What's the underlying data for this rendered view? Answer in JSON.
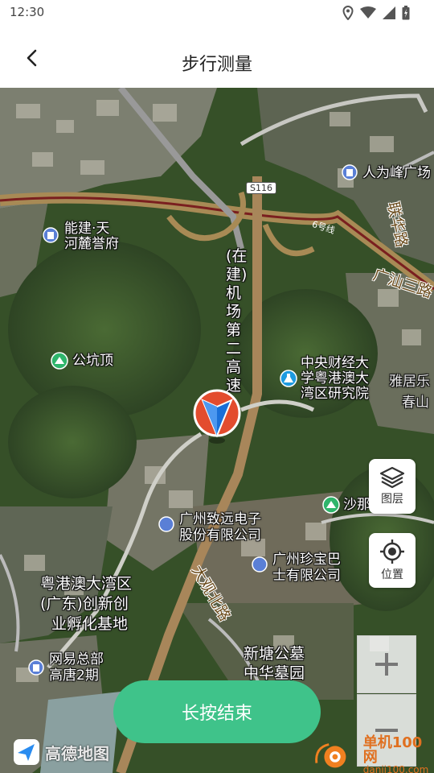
{
  "status_bar": {
    "time": "12:30"
  },
  "header": {
    "title": "步行测量"
  },
  "map": {
    "labels": {
      "renwei": "人为峰广场",
      "nengjian_1": "能建·天",
      "nengjian_2": "河麓誉府",
      "gongkengding": "公坑顶",
      "zhongyang_1": "中央财经大",
      "zhongyang_2": "学粤港澳大",
      "zhongyang_3": "湾区研究院",
      "yaju_1": "雅居乐",
      "yaju_2": "春山",
      "shana": "沙那",
      "zhiyuan_1": "广州致远电子",
      "zhiyuan_2": "股份有限公司",
      "zhenbao_1": "广州珍宝巴",
      "zhenbao_2": "士有限公司",
      "yuegang_1": "粤港澳大湾区",
      "yuegang_2": "(广东)创新创",
      "yuegang_3": "业孵化基地",
      "wangyi_1": "网易总部",
      "wangyi_2": "高唐2期",
      "xintang_1": "新塘公墓",
      "xintang_2": "中华墓园",
      "road_jichang": "(在建)机场第二高速",
      "road_daguan": "大观北路",
      "road_lianhua": "联华路",
      "road_guangshan": "广汕三路",
      "road_shield": "S116",
      "metro_line": "6号线"
    },
    "layers_label": "图层",
    "location_label": "位置",
    "zoom_in": "+",
    "zoom_out": "−",
    "logo_text": "高德地图"
  },
  "end_button": {
    "label": "长按结束"
  },
  "watermark": {
    "line1": "单机100网",
    "line2": "danji100.com"
  },
  "colors": {
    "accent": "#3fc38a",
    "poi_blue": "#5a7fd6",
    "poi_green": "#2fb56b"
  }
}
